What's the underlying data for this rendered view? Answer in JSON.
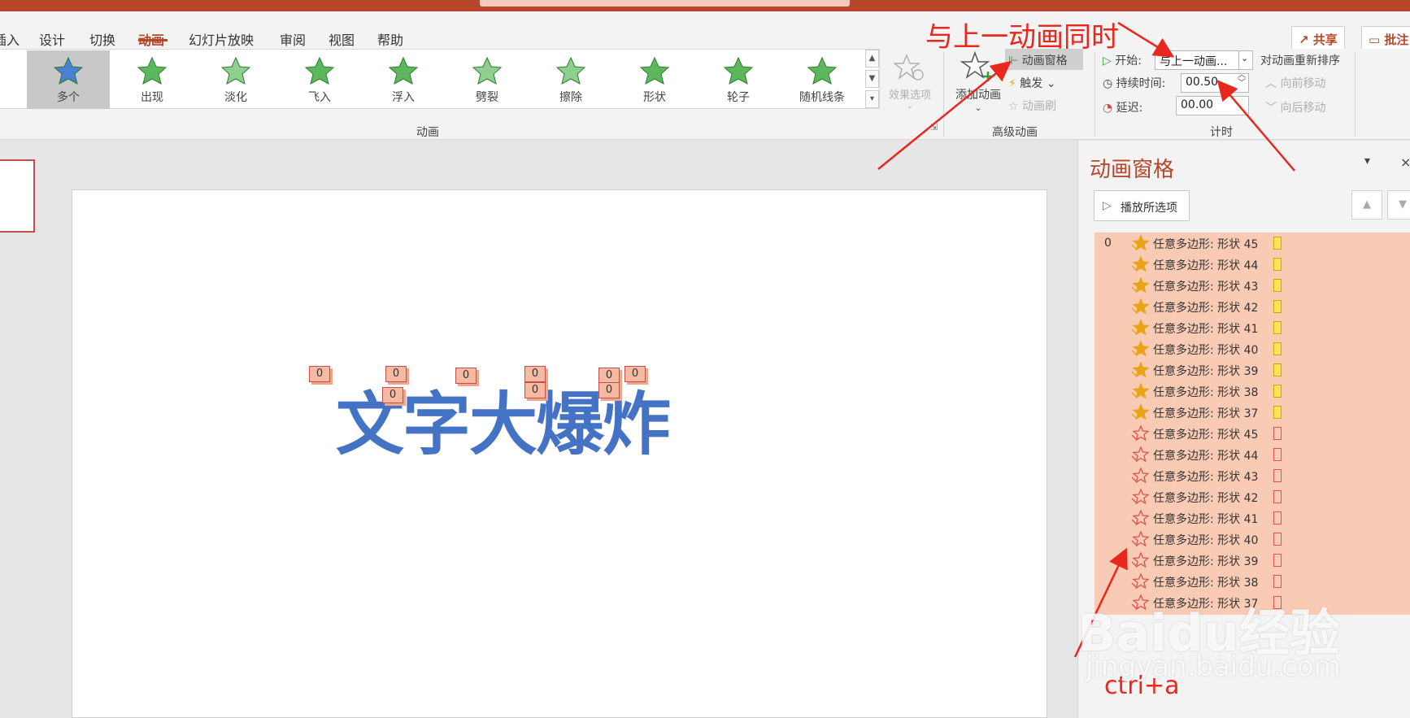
{
  "tabs": [
    {
      "label": "插入",
      "active": false
    },
    {
      "label": "设计",
      "active": false
    },
    {
      "label": "切换",
      "active": false
    },
    {
      "label": "动画",
      "active": true
    },
    {
      "label": "幻灯片放映",
      "active": false
    },
    {
      "label": "审阅",
      "active": false
    },
    {
      "label": "视图",
      "active": false
    },
    {
      "label": "帮助",
      "active": false
    }
  ],
  "header_buttons": {
    "share": "共享",
    "comments": "批注"
  },
  "gallery": {
    "items": [
      {
        "label": "多个",
        "selected": true,
        "color": "#4a7fd4"
      },
      {
        "label": "出现",
        "selected": false,
        "color": "#5db85d"
      },
      {
        "label": "淡化",
        "selected": false,
        "color": "#8fd08f"
      },
      {
        "label": "飞入",
        "selected": false,
        "color": "#5db85d"
      },
      {
        "label": "浮入",
        "selected": false,
        "color": "#5db85d"
      },
      {
        "label": "劈裂",
        "selected": false,
        "color": "#8fd08f"
      },
      {
        "label": "擦除",
        "selected": false,
        "color": "#8fd08f"
      },
      {
        "label": "形状",
        "selected": false,
        "color": "#5db85d"
      },
      {
        "label": "轮子",
        "selected": false,
        "color": "#5db85d"
      },
      {
        "label": "随机线条",
        "selected": false,
        "color": "#5db85d"
      }
    ],
    "effect_options": "效果选项",
    "group_label": "动画"
  },
  "advanced": {
    "add_animation": "添加动画",
    "animation_pane": "动画窗格",
    "trigger": "触发",
    "animation_painter": "动画刷",
    "group_label": "高级动画"
  },
  "timing": {
    "start_label": "开始:",
    "start_value": "与上一动画...",
    "duration_label": "持续时间:",
    "duration_value": "00.50",
    "delay_label": "延迟:",
    "delay_value": "00.00",
    "reorder_label": "对动画重新排序",
    "move_earlier": "向前移动",
    "move_later": "向后移动",
    "group_label": "计时"
  },
  "slide": {
    "text": "文字大爆炸",
    "tag_value": "0"
  },
  "pane": {
    "title": "动画窗格",
    "play_button": "播放所选项",
    "first_index": "0",
    "rows": [
      {
        "label": "任意多边形: 形状 45",
        "kind": "entrance"
      },
      {
        "label": "任意多边形: 形状 44",
        "kind": "entrance"
      },
      {
        "label": "任意多边形: 形状 43",
        "kind": "entrance"
      },
      {
        "label": "任意多边形: 形状 42",
        "kind": "entrance"
      },
      {
        "label": "任意多边形: 形状 41",
        "kind": "entrance"
      },
      {
        "label": "任意多边形: 形状 40",
        "kind": "entrance"
      },
      {
        "label": "任意多边形: 形状 39",
        "kind": "entrance"
      },
      {
        "label": "任意多边形: 形状 38",
        "kind": "entrance"
      },
      {
        "label": "任意多边形: 形状 37",
        "kind": "entrance"
      },
      {
        "label": "任意多边形: 形状 45",
        "kind": "exit"
      },
      {
        "label": "任意多边形: 形状 44",
        "kind": "exit"
      },
      {
        "label": "任意多边形: 形状 43",
        "kind": "exit"
      },
      {
        "label": "任意多边形: 形状 42",
        "kind": "exit"
      },
      {
        "label": "任意多边形: 形状 41",
        "kind": "exit"
      },
      {
        "label": "任意多边形: 形状 40",
        "kind": "exit"
      },
      {
        "label": "任意多边形: 形状 39",
        "kind": "exit"
      },
      {
        "label": "任意多边形: 形状 38",
        "kind": "exit"
      },
      {
        "label": "任意多边形: 形状 37",
        "kind": "exit"
      }
    ]
  },
  "annotations": {
    "top": "与上一动画同时",
    "bottom": "ctrl+a"
  },
  "watermark": {
    "brand": "Baidu经验",
    "url": "jingyan.baidu.com"
  },
  "colors": {
    "accent": "#b7472a",
    "annotation": "#e8271f",
    "slide_text": "#4472c4",
    "list_bg": "#f9cbb5"
  }
}
